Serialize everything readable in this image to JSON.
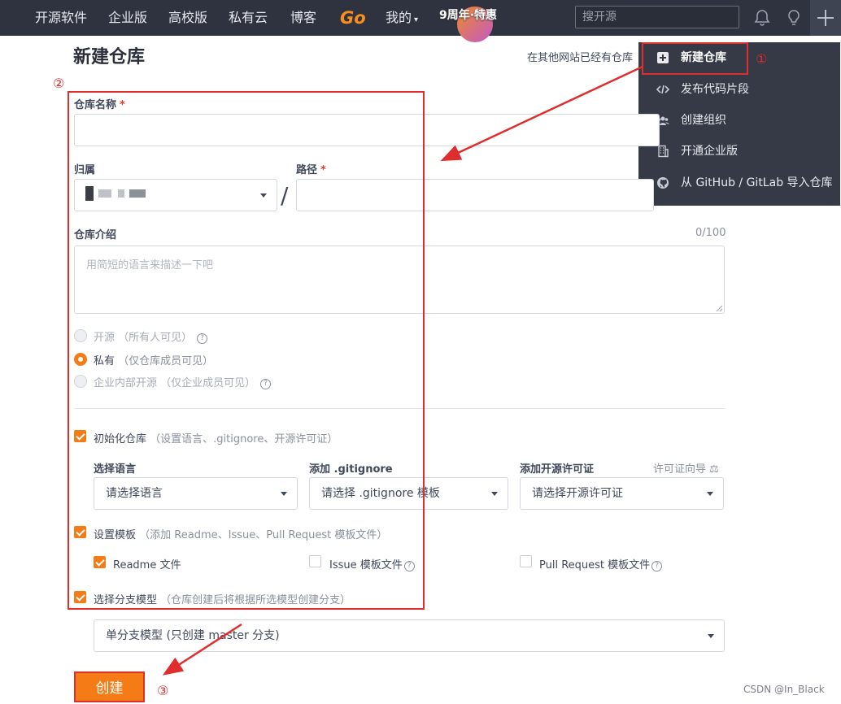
{
  "nav": {
    "items": [
      "开源软件",
      "企业版",
      "高校版",
      "私有云",
      "博客"
    ],
    "go_logo": "Go",
    "mine": "我的",
    "anniversary": "9周年·特惠",
    "search_placeholder": "搜开源"
  },
  "menu": {
    "items": [
      {
        "label": "新建仓库",
        "icon": "plus-square-icon"
      },
      {
        "label": "发布代码片段",
        "icon": "code-icon"
      },
      {
        "label": "创建组织",
        "icon": "users-icon"
      },
      {
        "label": "开通企业版",
        "icon": "building-icon"
      },
      {
        "label": "从 GitHub / GitLab 导入仓库",
        "icon": "github-icon"
      }
    ]
  },
  "page": {
    "title": "新建仓库",
    "import_text": "在其他网站已经有仓库"
  },
  "form": {
    "repo_name_label": "仓库名称",
    "required_mark": "*",
    "owner_label": "归属",
    "path_label": "路径",
    "slash": "/",
    "desc_label": "仓库介绍",
    "desc_counter": "0/100",
    "desc_placeholder": "用简短的语言来描述一下吧",
    "visibility": [
      {
        "label": "开源",
        "hint": "（所有人可见）",
        "selected": false,
        "disabled": true,
        "help": true
      },
      {
        "label": "私有",
        "hint": "（仅仓库成员可见）",
        "selected": true,
        "disabled": false,
        "help": false
      },
      {
        "label": "企业内部开源",
        "hint": "（仅企业成员可见）",
        "selected": false,
        "disabled": true,
        "help": true
      }
    ],
    "init_repo": {
      "label": "初始化仓库",
      "hint": "（设置语言、.gitignore、开源许可证）",
      "checked": true
    },
    "lang_label": "选择语言",
    "lang_value": "请选择语言",
    "gitignore_label": "添加 .gitignore",
    "gitignore_value": "请选择 .gitignore 模板",
    "license_label": "添加开源许可证",
    "license_guide": "许可证向导",
    "license_value": "请选择开源许可证",
    "template": {
      "label": "设置模板",
      "hint": "（添加 Readme、Issue、Pull Request 模板文件）",
      "checked": true
    },
    "readme": {
      "label": "Readme 文件",
      "checked": true
    },
    "issue": {
      "label": "Issue 模板文件",
      "checked": false
    },
    "pr": {
      "label": "Pull Request 模板文件",
      "checked": false
    },
    "branch": {
      "label": "选择分支模型",
      "hint": "（仓库创建后将根据所选模型创建分支）",
      "checked": true
    },
    "branch_value": "单分支模型 (只创建 master 分支)",
    "create_button": "创建"
  },
  "annotations": {
    "one": "①",
    "two": "②",
    "three": "③"
  },
  "watermark": "CSDN @In_Black",
  "colors": {
    "accent": "#f57b16",
    "annotation": "#e02e2e",
    "topbar": "#2f3340"
  }
}
